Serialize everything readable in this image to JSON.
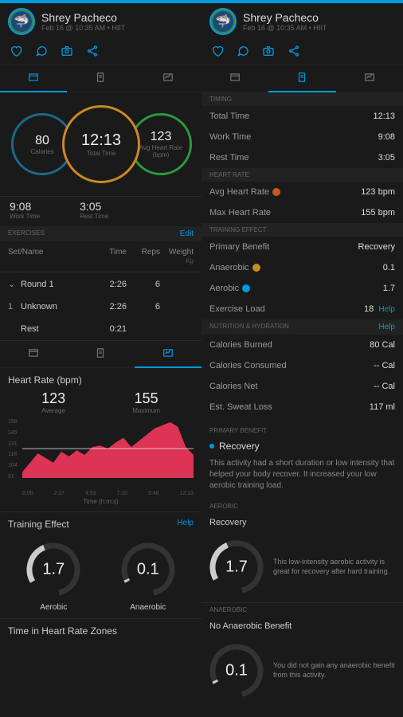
{
  "header": {
    "name": "Shrey Pacheco",
    "sub": "Feb 16 @ 10:35 AM • HIIT"
  },
  "circles": {
    "cal_val": "80",
    "cal_lbl": "Calories",
    "time_val": "12:13",
    "time_lbl": "Total Time",
    "hr_val": "123",
    "hr_lbl": "Avg Heart Rate (bpm)"
  },
  "times": {
    "work_val": "9:08",
    "work_lbl": "Work Time",
    "rest_val": "3:05",
    "rest_lbl": "Rest Time"
  },
  "exercises": {
    "hdr": "EXERCISES",
    "edit": "Edit",
    "cols": {
      "name": "Set/Name",
      "time": "Time",
      "reps": "Reps",
      "weight": "Weight",
      "weight_unit": "Kg"
    },
    "rows": [
      {
        "chev": "⌄",
        "name": "Round 1",
        "time": "2:26",
        "reps": "6",
        "kg": ""
      },
      {
        "chev": "1",
        "name": "Unknown",
        "time": "2:26",
        "reps": "6",
        "kg": ""
      },
      {
        "chev": "",
        "name": "Rest",
        "time": "0:21",
        "reps": "",
        "kg": ""
      }
    ]
  },
  "hrchart": {
    "title": "Heart Rate (bpm)",
    "avg_val": "123",
    "avg_lbl": "Average",
    "max_val": "155",
    "max_lbl": "Maximum",
    "y": [
      "156",
      "145",
      "131",
      "118",
      "104",
      "91"
    ],
    "x": [
      "0:00",
      "2:27",
      "4:53",
      "7:20",
      "9:46",
      "12:13"
    ],
    "axis": "Time (h:m:s)"
  },
  "te": {
    "title": "Training Effect",
    "help": "Help",
    "aerobic": "Aerobic",
    "aerobic_val": "1.7",
    "anaerobic": "Anaerobic",
    "anaerobic_val": "0.1"
  },
  "tiz": {
    "title": "Time in Heart Rate Zones"
  },
  "timing": {
    "hdr": "TIMING",
    "total_k": "Total Time",
    "total_v": "12:13",
    "work_k": "Work Time",
    "work_v": "9:08",
    "rest_k": "Rest Time",
    "rest_v": "3:05"
  },
  "hrsec": {
    "hdr": "HEART RATE",
    "avg_k": "Avg Heart Rate",
    "avg_v": "123 bpm",
    "max_k": "Max Heart Rate",
    "max_v": "155 bpm"
  },
  "tesec": {
    "hdr": "TRAINING EFFECT",
    "pb_k": "Primary Benefit",
    "pb_v": "Recovery",
    "an_k": "Anaerobic",
    "an_v": "0.1",
    "ae_k": "Aerobic",
    "ae_v": "1.7",
    "el_k": "Exercise Load",
    "el_v": "18",
    "help": "Help"
  },
  "nutr": {
    "hdr": "NUTRITION & HYDRATION",
    "help": "Help",
    "burn_k": "Calories Burned",
    "burn_v": "80 Cal",
    "cons_k": "Calories Consumed",
    "cons_v": "-- Cal",
    "net_k": "Calories Net",
    "net_v": "-- Cal",
    "sw_k": "Est. Sweat Loss",
    "sw_v": "117 ml"
  },
  "pbdetail": {
    "hdr": "PRIMARY BENEFIT",
    "title": "Recovery",
    "desc": "This activity had a short duration or low intensity that helped your body recover. It increased your low aerobic training load.",
    "aerobic_hdr": "AEROBIC",
    "aerobic_title": "Recovery",
    "aerobic_val": "1.7",
    "aerobic_desc": "This low-intensity aerobic activity is great for recovery after hard training.",
    "anaerobic_hdr": "ANAEROBIC",
    "anaerobic_title": "No Anaerobic Benefit",
    "anaerobic_val": "0.1",
    "anaerobic_desc": "You did not gain any anaerobic benefit from this activity."
  },
  "chart_data": {
    "type": "area",
    "title": "Heart Rate (bpm)",
    "xlabel": "Time (h:m:s)",
    "ylabel": "",
    "ylim": [
      91,
      156
    ],
    "x": [
      "0:00",
      "2:27",
      "4:53",
      "7:20",
      "9:46",
      "12:13"
    ],
    "values": [
      98,
      108,
      120,
      115,
      110,
      122,
      118,
      125,
      120,
      128,
      130,
      126,
      132,
      138,
      128,
      134,
      140,
      148,
      152,
      155,
      150,
      128,
      120
    ],
    "avg_line": 123
  }
}
